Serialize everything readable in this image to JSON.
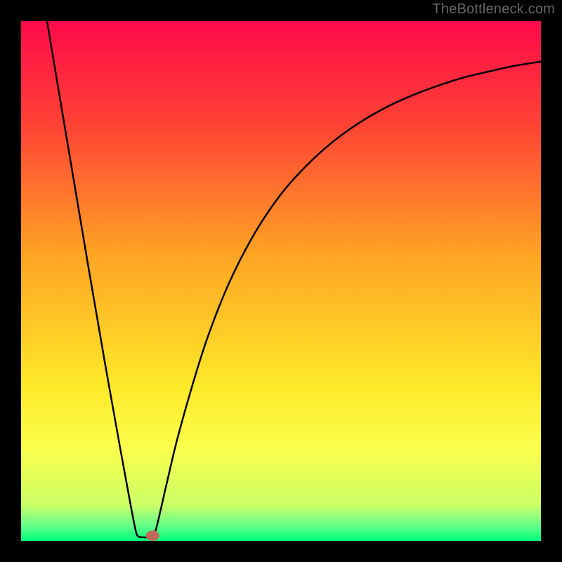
{
  "watermark": "TheBottleneck.com",
  "chart_data": {
    "type": "line",
    "title": "",
    "xlabel": "",
    "ylabel": "",
    "xlim": [
      0,
      100
    ],
    "ylim": [
      0,
      100
    ],
    "background": {
      "type": "vertical_gradient",
      "stops": [
        {
          "pos": 0.0,
          "color": "#ff0a4a"
        },
        {
          "pos": 0.2,
          "color": "#ff4335"
        },
        {
          "pos": 0.45,
          "color": "#ffa424"
        },
        {
          "pos": 0.7,
          "color": "#fde829"
        },
        {
          "pos": 0.82,
          "color": "#fbff4c"
        },
        {
          "pos": 0.93,
          "color": "#ccff66"
        },
        {
          "pos": 0.97,
          "color": "#66ff8a"
        },
        {
          "pos": 1.0,
          "color": "#00ff7b"
        }
      ]
    },
    "series": [
      {
        "name": "bottleneck-curve",
        "color": "#000000",
        "stroke_width": 2.5,
        "points": [
          {
            "x": 5.0,
            "y": 100.0
          },
          {
            "x": 7.0,
            "y": 88.0
          },
          {
            "x": 10.0,
            "y": 70.2
          },
          {
            "x": 13.0,
            "y": 52.4
          },
          {
            "x": 16.0,
            "y": 35.0
          },
          {
            "x": 19.0,
            "y": 18.2
          },
          {
            "x": 21.0,
            "y": 7.3
          },
          {
            "x": 22.0,
            "y": 2.2
          },
          {
            "x": 22.5,
            "y": 0.9
          },
          {
            "x": 23.5,
            "y": 0.7
          },
          {
            "x": 24.5,
            "y": 0.7
          },
          {
            "x": 25.3,
            "y": 1.0
          },
          {
            "x": 26.0,
            "y": 2.4
          },
          {
            "x": 28.0,
            "y": 11.0
          },
          {
            "x": 30.0,
            "y": 19.4
          },
          {
            "x": 33.0,
            "y": 30.1
          },
          {
            "x": 36.0,
            "y": 39.5
          },
          {
            "x": 40.0,
            "y": 49.6
          },
          {
            "x": 45.0,
            "y": 59.3
          },
          {
            "x": 50.0,
            "y": 66.7
          },
          {
            "x": 55.0,
            "y": 72.3
          },
          {
            "x": 60.0,
            "y": 76.8
          },
          {
            "x": 65.0,
            "y": 80.4
          },
          {
            "x": 70.0,
            "y": 83.3
          },
          {
            "x": 75.0,
            "y": 85.6
          },
          {
            "x": 80.0,
            "y": 87.5
          },
          {
            "x": 85.0,
            "y": 89.1
          },
          {
            "x": 90.0,
            "y": 90.3
          },
          {
            "x": 95.0,
            "y": 91.4
          },
          {
            "x": 100.0,
            "y": 92.2
          }
        ]
      }
    ],
    "markers": [
      {
        "name": "optimal-point",
        "x": 25.3,
        "y": 1.0,
        "rx": 1.3,
        "ry": 1.0,
        "color": "#c1695a"
      }
    ]
  }
}
